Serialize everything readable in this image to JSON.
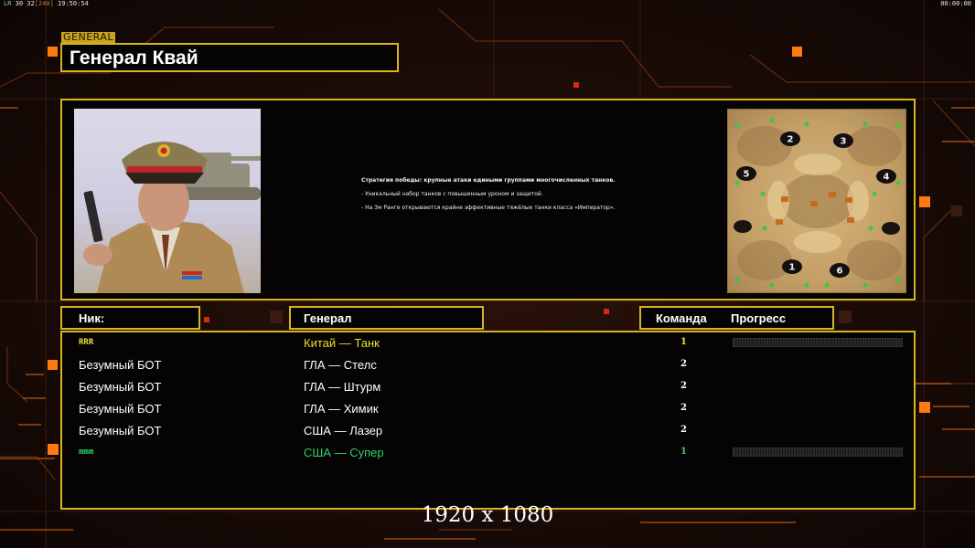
{
  "status_bar": {
    "lr": "LR",
    "fps": "30 32",
    "bracket": "[240]",
    "clock": "19:50:54",
    "timer": "00:00:00"
  },
  "general_tag": "GENERAL",
  "general_name": "Генерал Квай",
  "description": [
    "Стратегия победы: крупные атаки едиными группами многочисленных танков.",
    "- Уникальный набор танков с повышенным уроном и защитой.",
    "- На 3м Ранге открываются крайне эффективные тяжёлые танки класса «Император»."
  ],
  "map": {
    "start_positions": [
      "1",
      "2",
      "3",
      "4",
      "5",
      "6"
    ]
  },
  "headers": {
    "nick": "Ник:",
    "general": "Генерал",
    "team": "Команда",
    "progress": "Прогресс"
  },
  "players": [
    {
      "nick": "RRR",
      "general": "Китай — Танк",
      "team": "1",
      "color": "#e8e02c",
      "is_tag": true,
      "progress": 0.0
    },
    {
      "nick": "Безумный БОТ",
      "general": "ГЛА — Стелс",
      "team": "2",
      "color": "#ffffff",
      "is_tag": false
    },
    {
      "nick": "Безумный БОТ",
      "general": "ГЛА — Штурм",
      "team": "2",
      "color": "#ffffff",
      "is_tag": false
    },
    {
      "nick": "Безумный БОТ",
      "general": "ГЛА — Химик",
      "team": "2",
      "color": "#ffffff",
      "is_tag": false
    },
    {
      "nick": "Безумный БОТ",
      "general": "США — Лазер",
      "team": "2",
      "color": "#ffffff",
      "is_tag": false
    },
    {
      "nick": "mmm",
      "general": "США — Супер",
      "team": "1",
      "color": "#2fd36b",
      "is_tag": true,
      "progress": 0.0
    }
  ],
  "resolution_label": "1920 x 1080",
  "colors": {
    "accent": "#d6b422",
    "orange_light": "#ff7a10",
    "red_light": "#d42a10",
    "panel": "#050303"
  }
}
